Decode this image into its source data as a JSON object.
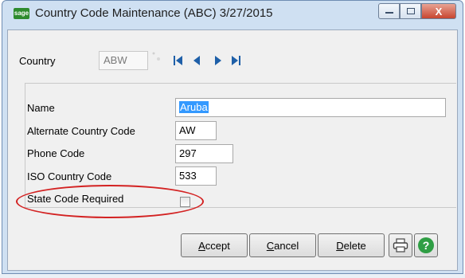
{
  "window": {
    "icon_text": "sage",
    "title": "Country Code Maintenance (ABC) 3/27/2015",
    "close_glyph": "X"
  },
  "country": {
    "label": "Country",
    "value": "ABW"
  },
  "form": {
    "name_label": "Name",
    "name_value": "Aruba",
    "alt_label": "Alternate Country Code",
    "alt_value": "AW",
    "phone_label": "Phone Code",
    "phone_value": "297",
    "iso_label": "ISO Country Code",
    "iso_value": "533",
    "state_label": "State Code Required",
    "state_checked": false
  },
  "buttons": {
    "accept_first": "A",
    "accept_rest": "ccept",
    "cancel_first": "C",
    "cancel_rest": "ancel",
    "delete_first": "D",
    "delete_rest": "elete",
    "help_glyph": "?"
  },
  "icons": [
    "app-icon",
    "lookup-icon",
    "first-record-icon",
    "previous-record-icon",
    "next-record-icon",
    "last-record-icon",
    "print-icon",
    "help-icon"
  ],
  "colors": {
    "selection": "#3399ff",
    "highlight_ellipse": "#d32222",
    "help": "#2f9e44",
    "nav_arrows": "#1e5fa8"
  }
}
